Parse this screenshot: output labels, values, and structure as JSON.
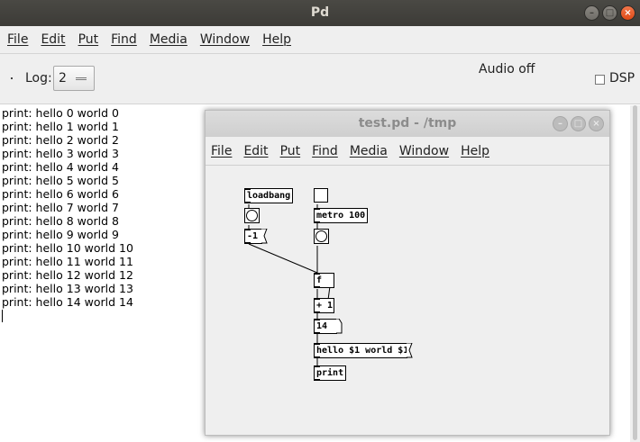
{
  "window": {
    "title": "Pd",
    "controls": [
      "minimize-icon",
      "maximize-icon",
      "close-icon"
    ]
  },
  "menu": [
    "File",
    "Edit",
    "Put",
    "Find",
    "Media",
    "Window",
    "Help"
  ],
  "toolbar": {
    "log_label": "Log:",
    "log_value": "2",
    "audio_status": "Audio off",
    "dsp_label": "DSP",
    "dsp_checked": false
  },
  "console": {
    "lines": [
      "print: hello 0 world 0",
      "print: hello 1 world 1",
      "print: hello 2 world 2",
      "print: hello 3 world 3",
      "print: hello 4 world 4",
      "print: hello 5 world 5",
      "print: hello 6 world 6",
      "print: hello 7 world 7",
      "print: hello 8 world 8",
      "print: hello 9 world 9",
      "print: hello 10 world 10",
      "print: hello 11 world 11",
      "print: hello 12 world 12",
      "print: hello 13 world 13",
      "print: hello 14 world 14"
    ]
  },
  "patch": {
    "title": "test.pd  - /tmp",
    "menu": [
      "File",
      "Edit",
      "Put",
      "Find",
      "Media",
      "Window",
      "Help"
    ],
    "objects": {
      "loadbang": "loadbang",
      "neg_one": "-1",
      "metro": "metro 100",
      "f": "f",
      "plus_one": "+ 1",
      "number": "14",
      "hello_msg": "hello $1 world $1",
      "print": "print"
    }
  },
  "colors": {
    "titlebar": "#3c3b37",
    "close_button": "#df4a16",
    "window_bg": "#efefef",
    "patch_title_text": "#8c8c8c"
  }
}
